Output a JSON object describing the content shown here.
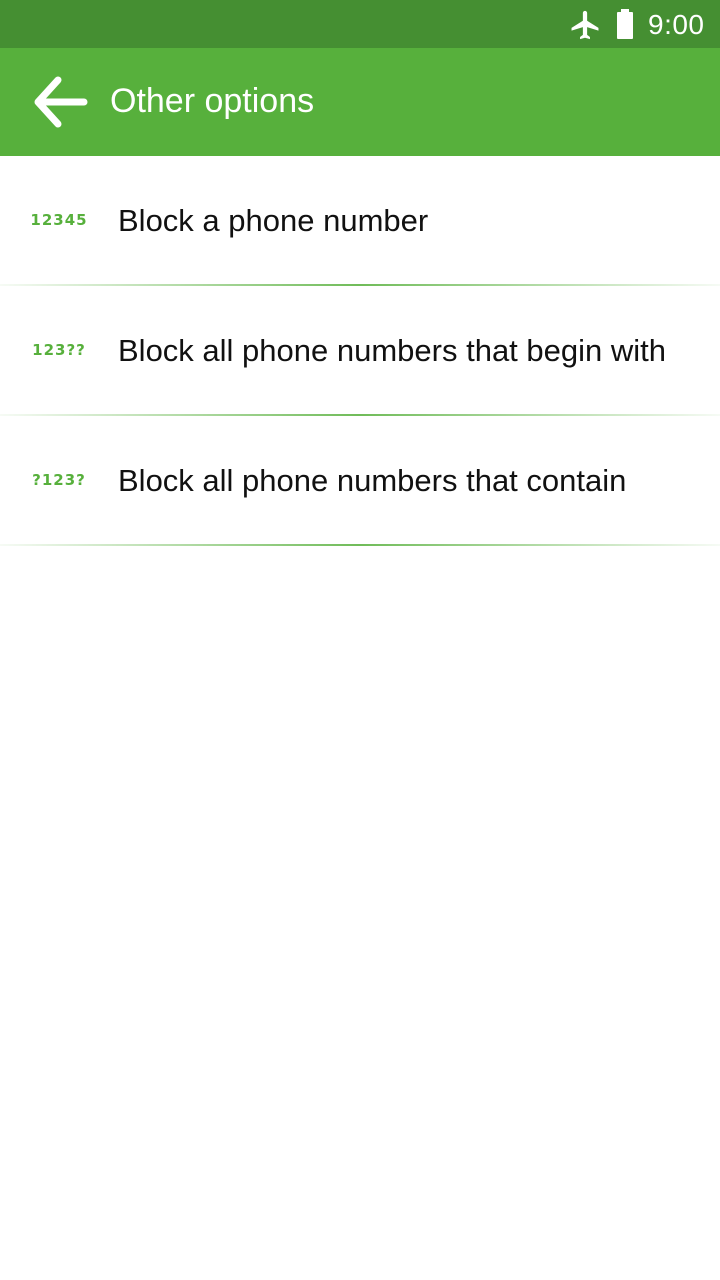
{
  "status_bar": {
    "time": "9:00",
    "icons": [
      "airplane-mode-icon",
      "battery-icon"
    ],
    "color": "#458f32"
  },
  "app_bar": {
    "title": "Other options",
    "back_icon": "arrow-back-icon",
    "color": "#57b03c"
  },
  "options": [
    {
      "badge": "12345",
      "label": "Block a phone number"
    },
    {
      "badge": "123??",
      "label": "Block all phone numbers that begin with"
    },
    {
      "badge": "?123?",
      "label": "Block all phone numbers that contain"
    }
  ],
  "accent_color": "#57b03c"
}
